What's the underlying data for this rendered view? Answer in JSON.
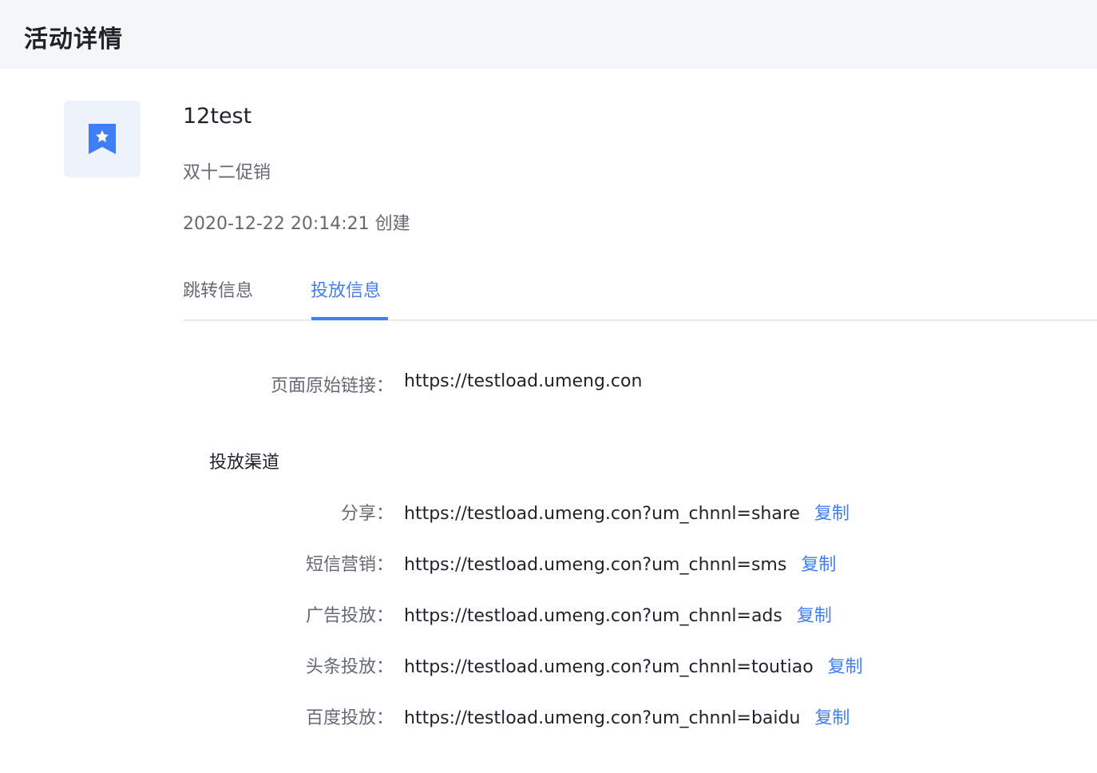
{
  "header": {
    "title": "活动详情"
  },
  "activity": {
    "icon": "bookmark-star-icon",
    "name": "12test",
    "subtitle": "双十二促销",
    "created": "2020-12-22 20:14:21 创建"
  },
  "tabs": [
    {
      "label": "跳转信息",
      "active": false
    },
    {
      "label": "投放信息",
      "active": true
    }
  ],
  "original_link": {
    "label": "页面原始链接：",
    "value": "https://testload.umeng.con"
  },
  "channels": {
    "title": "投放渠道",
    "items": [
      {
        "label": "分享：",
        "url": "https://testload.umeng.con?um_chnnl=share",
        "action": "复制"
      },
      {
        "label": "短信营销：",
        "url": "https://testload.umeng.con?um_chnnl=sms",
        "action": "复制"
      },
      {
        "label": "广告投放：",
        "url": "https://testload.umeng.con?um_chnnl=ads",
        "action": "复制"
      },
      {
        "label": "头条投放：",
        "url": "https://testload.umeng.con?um_chnnl=toutiao",
        "action": "复制"
      },
      {
        "label": "百度投放：",
        "url": "https://testload.umeng.con?um_chnnl=baidu",
        "action": "复制"
      }
    ]
  },
  "colors": {
    "accent": "#3f7ef5",
    "muted": "#646a73",
    "text": "#1f2329",
    "header_bg": "#f5f6f7",
    "icon_bg": "#eef2fa"
  }
}
